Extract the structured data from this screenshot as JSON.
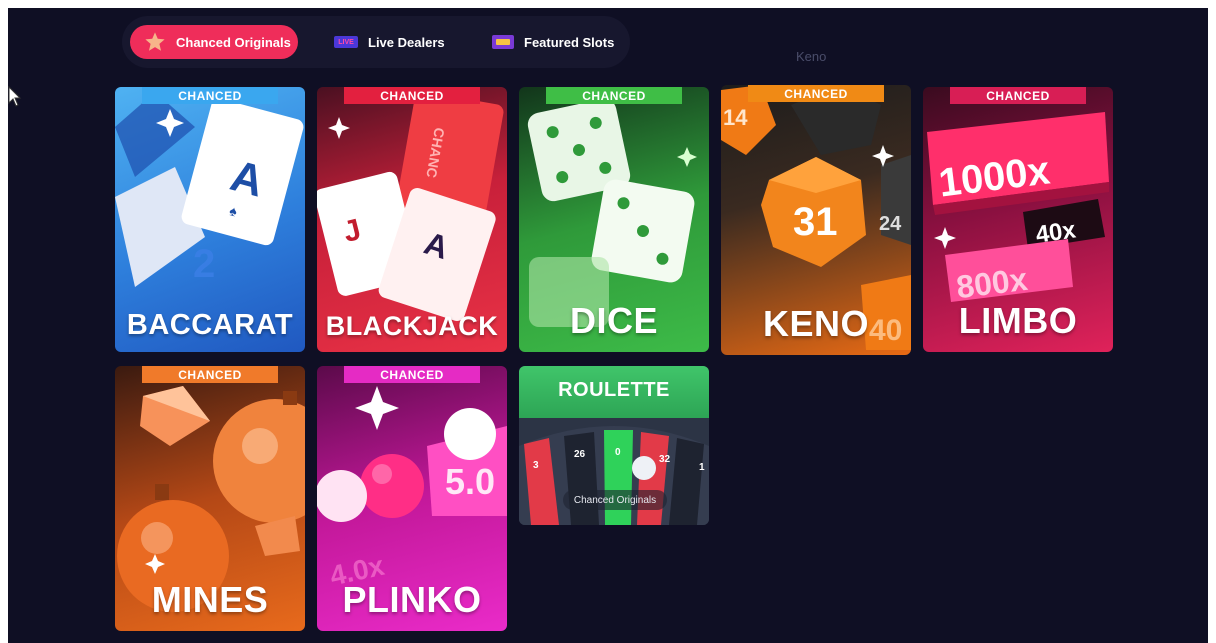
{
  "tabs": [
    {
      "label": "Chanced Originals",
      "icon": "star-icon",
      "active": true
    },
    {
      "label": "Live Dealers",
      "icon": "live-badge-icon",
      "badge": "LIVE",
      "active": false
    },
    {
      "label": "Featured Slots",
      "icon": "slot-machine-icon",
      "active": false
    }
  ],
  "tooltip": "Keno",
  "cards": {
    "baccarat": {
      "badge": "CHANCED",
      "title": "BACCARAT",
      "badge_color": "#3aa7ef"
    },
    "blackjack": {
      "badge": "CHANCED",
      "title": "BLACKJACK",
      "badge_color": "#e3203f"
    },
    "dice": {
      "badge": "CHANCED",
      "title": "DICE",
      "badge_color": "#3fbe46"
    },
    "keno": {
      "badge": "CHANCED",
      "title": "KENO",
      "badge_color": "#f08a15",
      "ball_number": "31",
      "side_numbers": [
        "14",
        "24",
        "40"
      ]
    },
    "limbo": {
      "badge": "CHANCED",
      "title": "LIMBO",
      "badge_color": "#d81e55",
      "multipliers": [
        "1000x",
        "40x",
        "800x"
      ]
    },
    "mines": {
      "badge": "CHANCED",
      "title": "MINES",
      "badge_color": "#f07a2a"
    },
    "plinko": {
      "badge": "CHANCED",
      "title": "PLINKO",
      "badge_color": "#e52bc4",
      "multipliers": [
        "5.0",
        "4.0x"
      ]
    },
    "roulette": {
      "title": "ROULETTE",
      "numbers": [
        "3",
        "26",
        "0",
        "32",
        "1"
      ],
      "hover_label": "Chanced Originals"
    }
  }
}
